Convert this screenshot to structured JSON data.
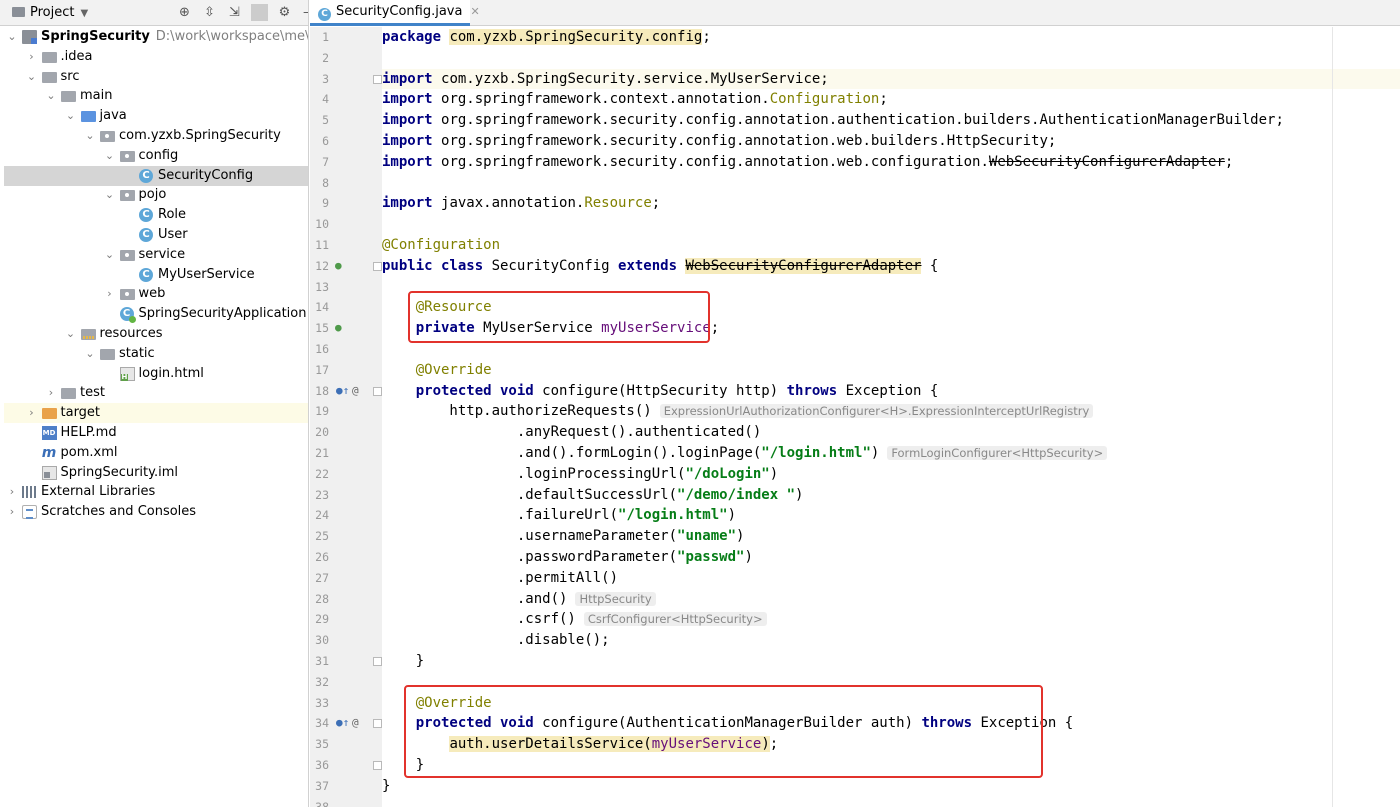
{
  "project_panel": {
    "title": "Project",
    "tree": [
      {
        "label": "SpringSecurity",
        "path": "D:\\work\\workspace\\me\\SpringSecurity",
        "icon": "module-icon",
        "depth": 0,
        "arrow": "open",
        "bold": true
      },
      {
        "label": ".idea",
        "icon": "folder-icon",
        "depth": 1,
        "arrow": "closed"
      },
      {
        "label": "src",
        "icon": "folder-icon",
        "depth": 1,
        "arrow": "open"
      },
      {
        "label": "main",
        "icon": "folder-icon",
        "depth": 2,
        "arrow": "open"
      },
      {
        "label": "java",
        "icon": "source-folder-icon",
        "depth": 3,
        "arrow": "open"
      },
      {
        "label": "com.yzxb.SpringSecurity",
        "icon": "package-icon",
        "depth": 4,
        "arrow": "open"
      },
      {
        "label": "config",
        "icon": "package-icon",
        "depth": 5,
        "arrow": "open"
      },
      {
        "label": "SecurityConfig",
        "icon": "class-icon",
        "depth": 6,
        "arrow": "none",
        "selected": true
      },
      {
        "label": "pojo",
        "icon": "package-icon",
        "depth": 5,
        "arrow": "open"
      },
      {
        "label": "Role",
        "icon": "class-icon",
        "depth": 6,
        "arrow": "none"
      },
      {
        "label": "User",
        "icon": "class-icon",
        "depth": 6,
        "arrow": "none"
      },
      {
        "label": "service",
        "icon": "package-icon",
        "depth": 5,
        "arrow": "open"
      },
      {
        "label": "MyUserService",
        "icon": "class-icon",
        "depth": 6,
        "arrow": "none"
      },
      {
        "label": "web",
        "icon": "package-icon",
        "depth": 5,
        "arrow": "closed"
      },
      {
        "label": "SpringSecurityApplication",
        "icon": "spring-app-icon",
        "depth": 5,
        "arrow": "none"
      },
      {
        "label": "resources",
        "icon": "resources-folder-icon",
        "depth": 3,
        "arrow": "open"
      },
      {
        "label": "static",
        "icon": "folder-icon",
        "depth": 4,
        "arrow": "open"
      },
      {
        "label": "login.html",
        "icon": "html-file-icon",
        "depth": 5,
        "arrow": "none"
      },
      {
        "label": "test",
        "icon": "folder-icon",
        "depth": 2,
        "arrow": "closed"
      },
      {
        "label": "target",
        "icon": "target-folder-icon",
        "depth": 1,
        "arrow": "closed",
        "highlight": true
      },
      {
        "label": "HELP.md",
        "icon": "markdown-file-icon",
        "depth": 1,
        "arrow": "none"
      },
      {
        "label": "pom.xml",
        "icon": "maven-file-icon",
        "depth": 1,
        "arrow": "none"
      },
      {
        "label": "SpringSecurity.iml",
        "icon": "iml-file-icon",
        "depth": 1,
        "arrow": "none"
      },
      {
        "label": "External Libraries",
        "icon": "libraries-icon",
        "depth": 0,
        "arrow": "closed"
      },
      {
        "label": "Scratches and Consoles",
        "icon": "scratches-icon",
        "depth": 0,
        "arrow": "closed"
      }
    ]
  },
  "editor": {
    "tab_label": "SecurityConfig.java",
    "gutter_icons": {
      "12": "bean-icon",
      "15": "bean-icon",
      "18": "override-icon",
      "34": "override-icon"
    },
    "gutter_marker_text": "@",
    "lines": [
      [
        {
          "t": "package ",
          "c": "kw"
        },
        {
          "t": "com.yzxb.SpringSecurity.config",
          "c": "hlbg"
        },
        {
          "t": ";"
        }
      ],
      [],
      [
        {
          "t": "import ",
          "c": "kw"
        },
        {
          "t": "com.yzxb.SpringSecurity.service.MyUserService;"
        }
      ],
      [
        {
          "t": "import ",
          "c": "kw"
        },
        {
          "t": "org.springframework.context.annotation."
        },
        {
          "t": "Configuration",
          "c": "ann"
        },
        {
          "t": ";"
        }
      ],
      [
        {
          "t": "import ",
          "c": "kw"
        },
        {
          "t": "org.springframework.security.config.annotation.authentication.builders.AuthenticationManagerBuilder;"
        }
      ],
      [
        {
          "t": "import ",
          "c": "kw"
        },
        {
          "t": "org.springframework.security.config.annotation.web.builders.HttpSecurity;"
        }
      ],
      [
        {
          "t": "import ",
          "c": "kw"
        },
        {
          "t": "org.springframework.security.config.annotation.web.configuration."
        },
        {
          "t": "WebSecurityConfigurerAdapter",
          "c": "del"
        },
        {
          "t": ";"
        }
      ],
      [],
      [
        {
          "t": "import ",
          "c": "kw"
        },
        {
          "t": "javax.annotation."
        },
        {
          "t": "Resource",
          "c": "ann"
        },
        {
          "t": ";"
        }
      ],
      [],
      [
        {
          "t": "@Configuration",
          "c": "ann"
        }
      ],
      [
        {
          "t": "public class ",
          "c": "kw"
        },
        {
          "t": "SecurityConfig "
        },
        {
          "t": "extends ",
          "c": "kw"
        },
        {
          "t": "WebSecurityConfigurerAdapter",
          "c": "del hlbg"
        },
        {
          "t": " {"
        }
      ],
      [],
      [
        {
          "t": "    "
        },
        {
          "t": "@Resource",
          "c": "ann"
        }
      ],
      [
        {
          "t": "    "
        },
        {
          "t": "private ",
          "c": "kw"
        },
        {
          "t": "MyUserService "
        },
        {
          "t": "myUserService",
          "c": "fld"
        },
        {
          "t": ";"
        }
      ],
      [],
      [
        {
          "t": "    "
        },
        {
          "t": "@Override",
          "c": "ann"
        }
      ],
      [
        {
          "t": "    "
        },
        {
          "t": "protected void ",
          "c": "kw"
        },
        {
          "t": "configure(HttpSecurity http) "
        },
        {
          "t": "throws ",
          "c": "kw"
        },
        {
          "t": "Exception {"
        }
      ],
      [
        {
          "t": "        http.authorizeRequests()"
        },
        {
          "t": "ExpressionUrlAuthorizationConfigurer<H>.ExpressionInterceptUrlRegistry",
          "c": "hint"
        }
      ],
      [
        {
          "t": "                .anyRequest().authenticated()"
        }
      ],
      [
        {
          "t": "                .and().formLogin().loginPage("
        },
        {
          "t": "\"/login.html\"",
          "c": "str"
        },
        {
          "t": ")"
        },
        {
          "t": "FormLoginConfigurer<HttpSecurity>",
          "c": "hint"
        }
      ],
      [
        {
          "t": "                .loginProcessingUrl("
        },
        {
          "t": "\"/doLogin\"",
          "c": "str"
        },
        {
          "t": ")"
        }
      ],
      [
        {
          "t": "                .defaultSuccessUrl("
        },
        {
          "t": "\"/demo/index \"",
          "c": "str"
        },
        {
          "t": ")"
        }
      ],
      [
        {
          "t": "                .failureUrl("
        },
        {
          "t": "\"/login.html\"",
          "c": "str"
        },
        {
          "t": ")"
        }
      ],
      [
        {
          "t": "                .usernameParameter("
        },
        {
          "t": "\"uname\"",
          "c": "str"
        },
        {
          "t": ")"
        }
      ],
      [
        {
          "t": "                .passwordParameter("
        },
        {
          "t": "\"passwd\"",
          "c": "str"
        },
        {
          "t": ")"
        }
      ],
      [
        {
          "t": "                .permitAll()"
        }
      ],
      [
        {
          "t": "                .and()"
        },
        {
          "t": "HttpSecurity",
          "c": "hint"
        }
      ],
      [
        {
          "t": "                .csrf()"
        },
        {
          "t": "CsrfConfigurer<HttpSecurity>",
          "c": "hint"
        }
      ],
      [
        {
          "t": "                .disable();"
        }
      ],
      [
        {
          "t": "    }"
        }
      ],
      [],
      [
        {
          "t": "    "
        },
        {
          "t": "@Override",
          "c": "ann"
        }
      ],
      [
        {
          "t": "    "
        },
        {
          "t": "protected void ",
          "c": "kw"
        },
        {
          "t": "configure(AuthenticationManagerBuilder auth) "
        },
        {
          "t": "throws ",
          "c": "kw"
        },
        {
          "t": "Exception {"
        }
      ],
      [
        {
          "t": "        "
        },
        {
          "t": "auth.userDetailsService(",
          "c": "hlbg"
        },
        {
          "t": "myUserService",
          "c": "fld hlbg"
        },
        {
          "t": ")",
          "c": "hlbg"
        },
        {
          "t": ";"
        }
      ],
      [
        {
          "t": "    }"
        }
      ],
      [
        {
          "t": "}"
        }
      ],
      []
    ]
  }
}
